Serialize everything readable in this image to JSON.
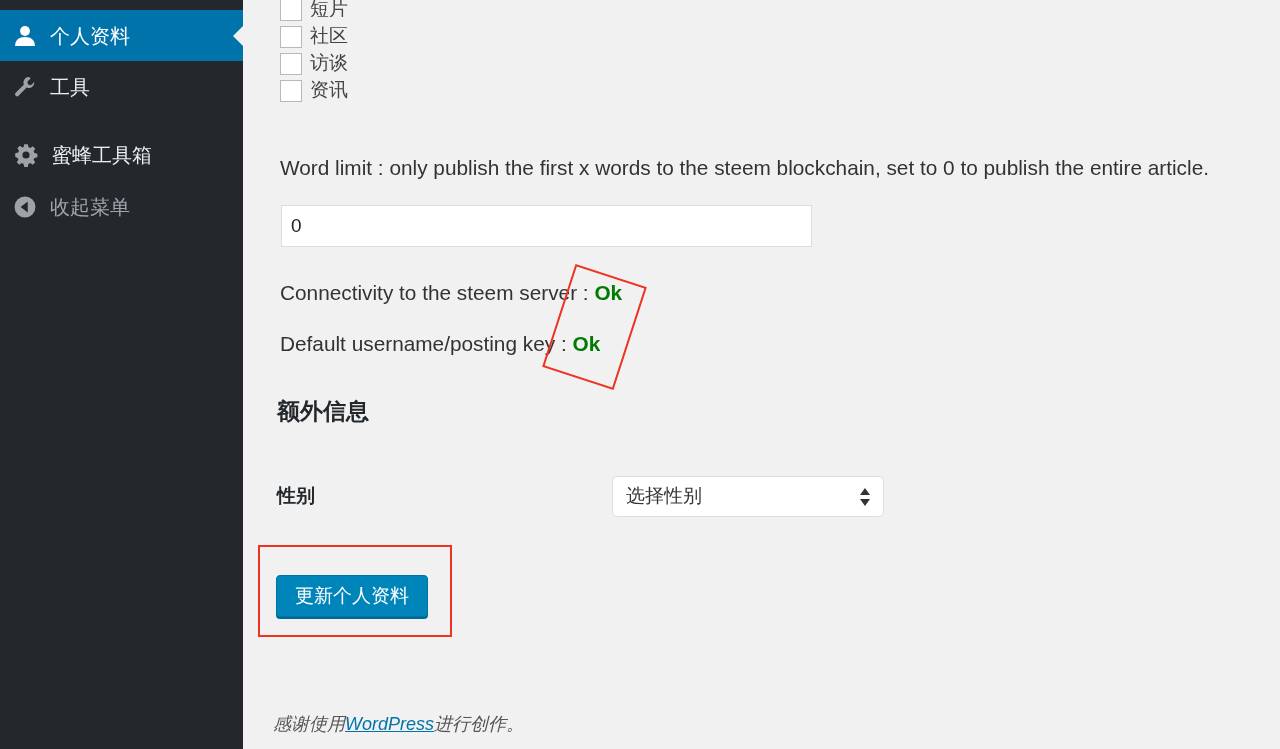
{
  "sidebar": {
    "items": [
      {
        "kind": "person",
        "label": "个人资料",
        "selected": true
      },
      {
        "kind": "wrench",
        "label": "工具",
        "selected": false
      },
      {
        "kind": "gear",
        "label": "蜜蜂工具箱",
        "selected": false
      },
      {
        "kind": "collapse",
        "label": "收起菜单",
        "selected": false
      }
    ]
  },
  "categories": [
    {
      "label": "短片",
      "checked": false
    },
    {
      "label": "社区",
      "checked": false
    },
    {
      "label": "访谈",
      "checked": false
    },
    {
      "label": "资讯",
      "checked": false
    }
  ],
  "word_limit": {
    "label": "Word limit : only publish the first x words to the steem blockchain, set to 0 to publish the entire article.",
    "value": "0"
  },
  "status": [
    {
      "label": "Connectivity to the steem server :",
      "value": "Ok"
    },
    {
      "label": "Default username/posting key :",
      "value": "Ok"
    }
  ],
  "extra_info": {
    "heading": "额外信息",
    "gender_label": "性别",
    "gender_select": "选择性别"
  },
  "submit_button": "更新个人资料",
  "footer": {
    "before": "感谢使用",
    "link": "WordPress",
    "after": "进行创作。"
  }
}
